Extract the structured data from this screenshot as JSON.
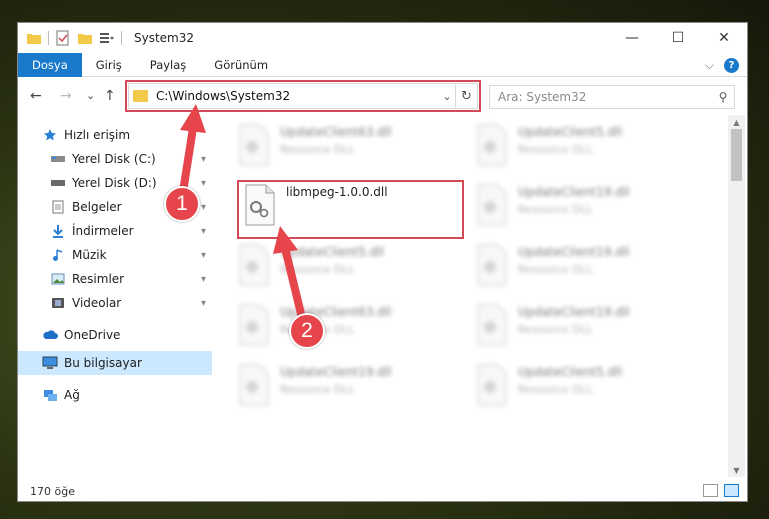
{
  "window": {
    "title": "System32",
    "controls": {
      "minimize": "—",
      "maximize": "☐",
      "close": "✕"
    }
  },
  "ribbon": {
    "tabs": [
      "Dosya",
      "Giriş",
      "Paylaş",
      "Görünüm"
    ],
    "expand_glyph": "⌵",
    "help_glyph": "?"
  },
  "nav": {
    "back": "←",
    "forward": "→",
    "recent": "⌄",
    "up": "↑",
    "address": "C:\\Windows\\System32",
    "address_drop": "⌄",
    "refresh": "↻",
    "search_placeholder": "Ara: System32",
    "search_icon": "⚲"
  },
  "sidebar": {
    "items": [
      {
        "label": "Hızlı erişim",
        "icon": "star-icon"
      },
      {
        "label": "Yerel Disk (C:)",
        "icon": "drive-icon",
        "pinned": true
      },
      {
        "label": "Yerel Disk (D:)",
        "icon": "drive-icon",
        "pinned": true
      },
      {
        "label": "Belgeler",
        "icon": "document-icon",
        "pinned": true
      },
      {
        "label": "İndirmeler",
        "icon": "download-icon",
        "pinned": true
      },
      {
        "label": "Müzik",
        "icon": "music-icon",
        "pinned": true
      },
      {
        "label": "Resimler",
        "icon": "pictures-icon",
        "pinned": true
      },
      {
        "label": "Videolar",
        "icon": "video-icon",
        "pinned": true
      },
      {
        "label": "OneDrive",
        "icon": "cloud-icon"
      },
      {
        "label": "Bu bilgisayar",
        "icon": "computer-icon",
        "selected": true
      },
      {
        "label": "Ağ",
        "icon": "network-icon"
      }
    ],
    "pin_glyph": "📌"
  },
  "files": [
    {
      "name": "UpdateClient63.dll",
      "desc": "Resource DLL"
    },
    {
      "name": "UpdateClient5.dll",
      "desc": "Resource DLL"
    },
    {
      "name": "libmpeg-1.0.0.dll",
      "desc": ""
    },
    {
      "name": "UpdateClient19.dll",
      "desc": "Resource DLL"
    },
    {
      "name": "UpdateClient5.dll",
      "desc": "Resource DLL"
    },
    {
      "name": "UpdateClient19.dll",
      "desc": "Resource DLL"
    },
    {
      "name": "UpdateClient63.dll",
      "desc": "Resource DLL"
    },
    {
      "name": "UpdateClient19.dll",
      "desc": "Resource DLL"
    },
    {
      "name": "UpdateClient19.dll",
      "desc": "Resource DLL"
    },
    {
      "name": "UpdateClient5.dll",
      "desc": "Resource DLL"
    }
  ],
  "status": {
    "count": "170 öğe"
  },
  "callouts": [
    "1",
    "2"
  ],
  "colors": {
    "accent": "#1979ca",
    "highlight": "#d24a55",
    "callout": "#e6454c",
    "selected": "#cce8ff"
  }
}
